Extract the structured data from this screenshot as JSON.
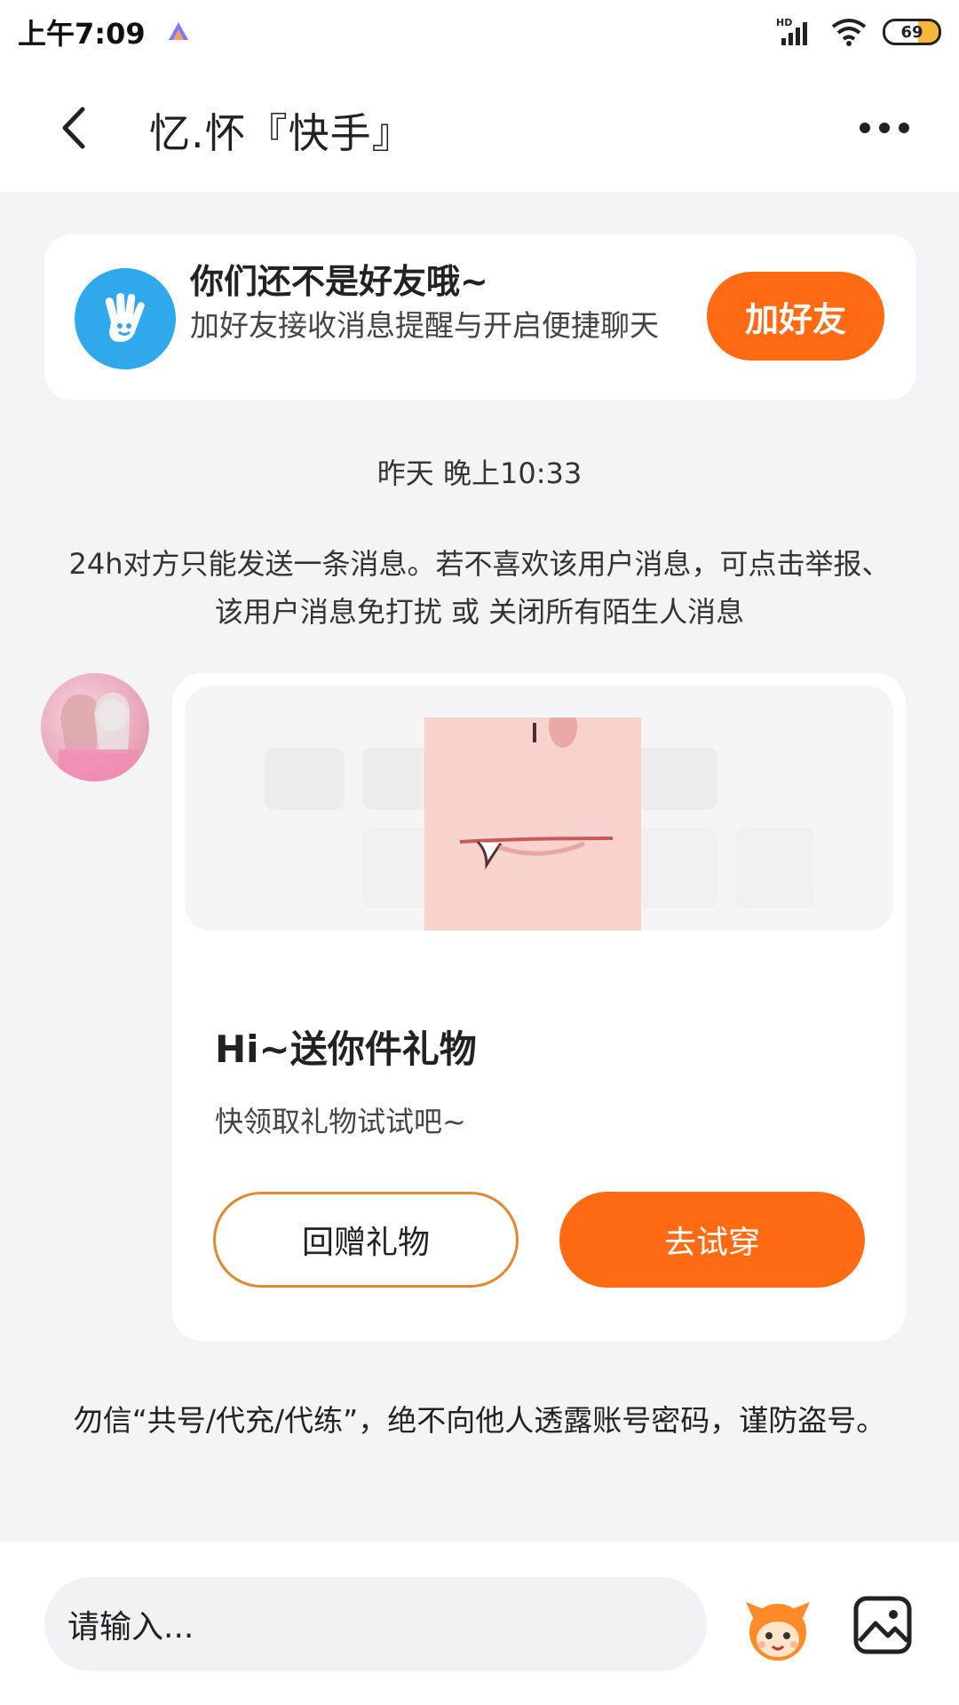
{
  "status_bar": {
    "time": "上午7:09",
    "battery": "69",
    "network": "HD"
  },
  "header": {
    "title": "忆.怀『快手』",
    "back_icon": "chevron-left-icon",
    "more_icon": "more-dots-icon"
  },
  "friend_banner": {
    "title": "你们还不是好友哦~",
    "description": "加好友接收消息提醒与开启便捷聊天",
    "button_label": "加好友",
    "icon": "wave-hand-icon",
    "accent_color": "#ff6a13"
  },
  "timestamp": "昨天 晚上10:33",
  "notice": "24h对方只能发送一条消息。若不喜欢该用户消息，可点击举报、该用户消息免打扰 或 关闭所有陌生人消息",
  "gift_card": {
    "title": "Hi~送你件礼物",
    "subtitle": "快领取礼物试试吧~",
    "return_button": "回赠礼物",
    "try_button": "去试穿"
  },
  "warning": "勿信“共号/代充/代练”，绝不向他人透露账号密码，谨防盗号。",
  "input_bar": {
    "placeholder": "请输入...",
    "emoji_icon": "emoji-mascot-icon",
    "image_icon": "image-icon"
  }
}
